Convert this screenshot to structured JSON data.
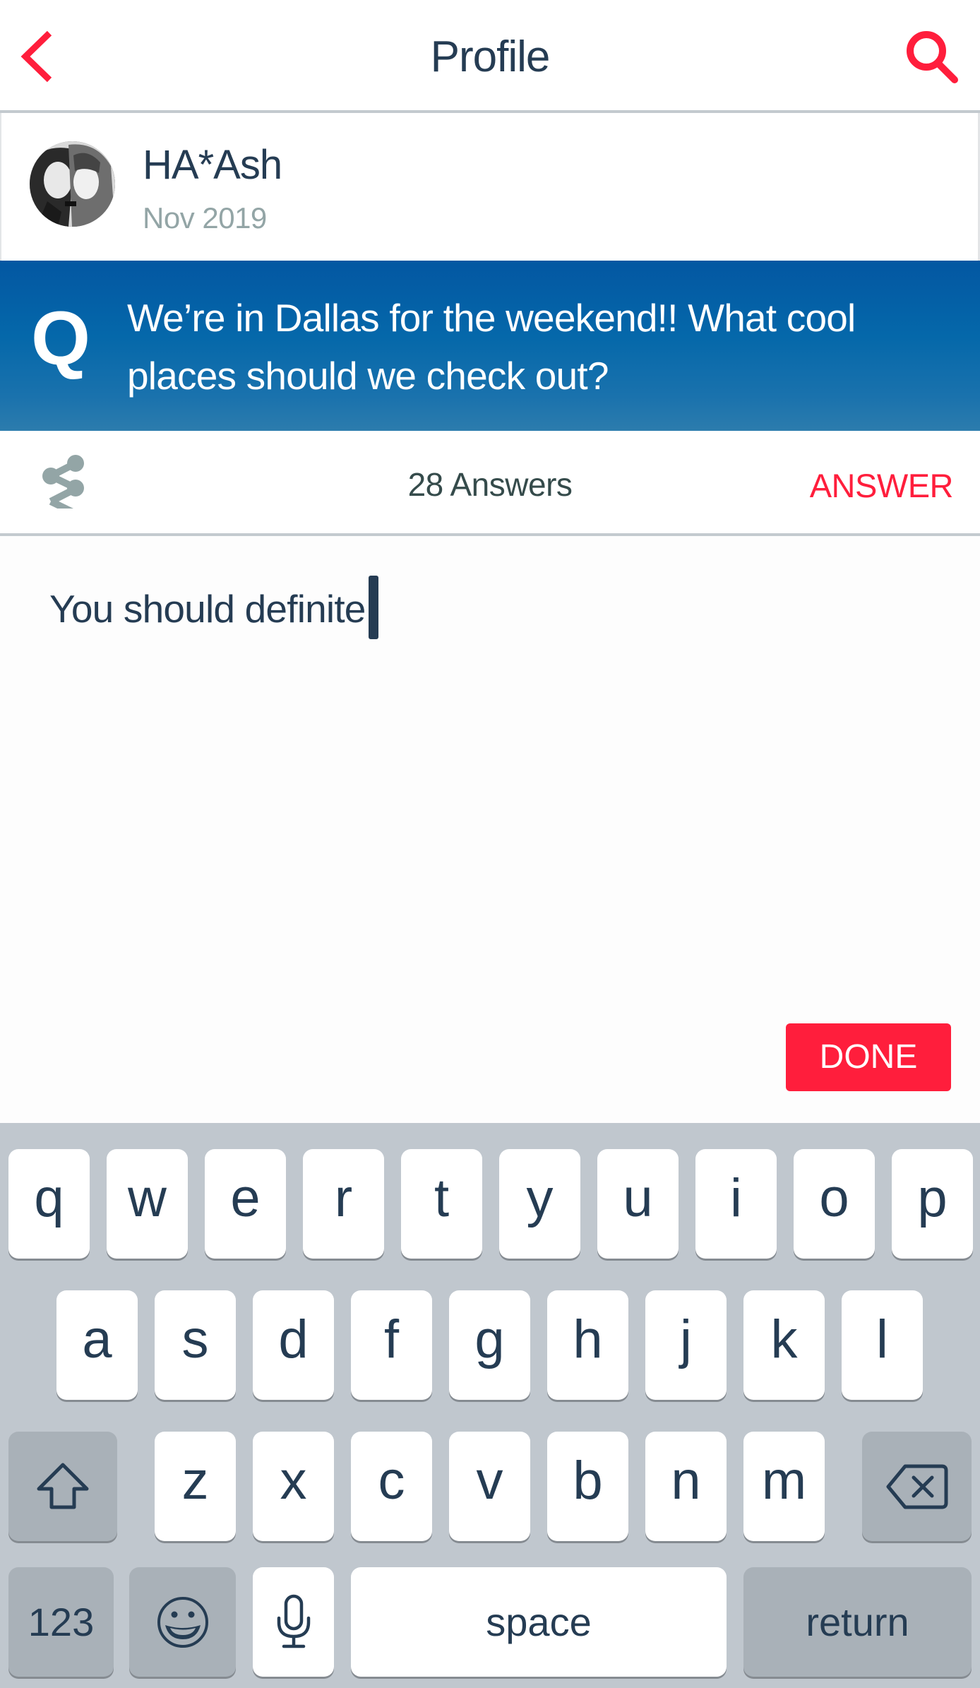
{
  "header": {
    "title": "Profile",
    "back_icon": "chevron-left-icon",
    "search_icon": "search-icon"
  },
  "profile": {
    "name": "HA*Ash",
    "date": "Nov 2019",
    "avatar": "avatar-photo"
  },
  "question": {
    "marker": "Q",
    "text": "We’re in Dallas for the weekend!! What cool places should we check out?"
  },
  "actions": {
    "share_icon": "share-icon",
    "answers_count": "28 Answers",
    "answer_label": "ANSWER"
  },
  "editor": {
    "value": "You should definite",
    "done_label": "DONE"
  },
  "keyboard": {
    "row1": [
      "q",
      "w",
      "e",
      "r",
      "t",
      "y",
      "u",
      "i",
      "o",
      "p"
    ],
    "row2": [
      "a",
      "s",
      "d",
      "f",
      "g",
      "h",
      "j",
      "k",
      "l"
    ],
    "row3": [
      "z",
      "x",
      "c",
      "v",
      "b",
      "n",
      "m"
    ],
    "shift_icon": "shift-icon",
    "backspace_icon": "backspace-icon",
    "numbers_label": "123",
    "emoji_icon": "emoji-icon",
    "mic_icon": "microphone-icon",
    "space_label": "space",
    "return_label": "return"
  },
  "colors": {
    "accent": "#ff1e3c",
    "text_primary": "#253c53",
    "text_muted": "#93a5a6",
    "banner_top": "#0357a2",
    "banner_bottom": "#2c7cad",
    "keyboard_bg": "#c0c7ce",
    "key_dark": "#a9b1b8"
  }
}
